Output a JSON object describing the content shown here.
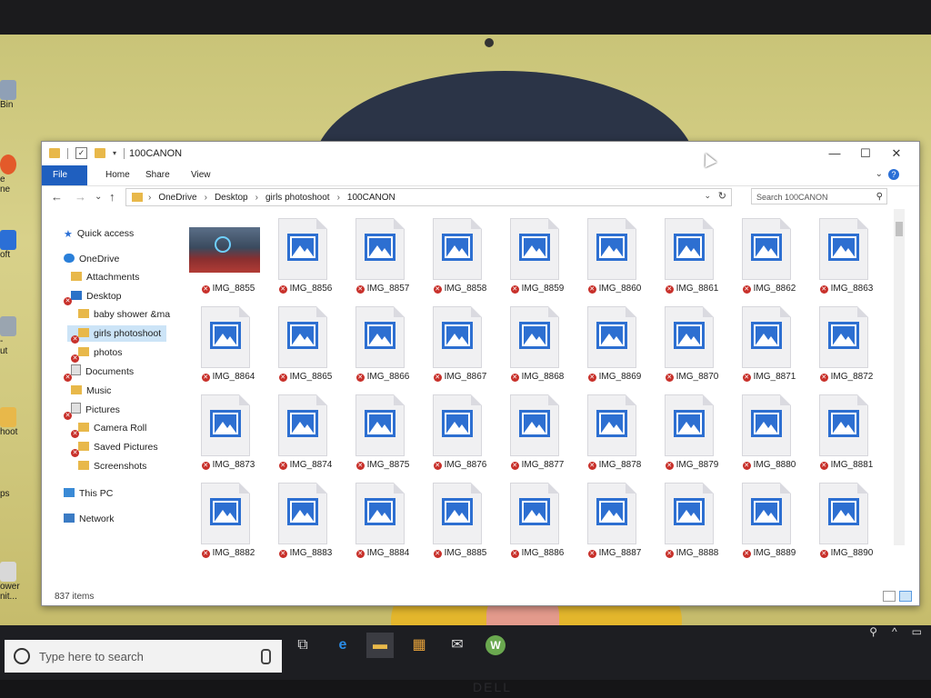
{
  "desktop": {
    "icons": [
      {
        "label": "Bin",
        "y": 0
      },
      {
        "label": "e",
        "y": 1
      },
      {
        "label": "ne",
        "y": 2
      },
      {
        "label": "oft",
        "y": 3
      },
      {
        "label": "-",
        "y": 4
      },
      {
        "label": "ut",
        "y": 5
      },
      {
        "label": "hoot",
        "y": 6
      },
      {
        "label": "ps",
        "y": 7
      },
      {
        "label": "ower",
        "y": 8
      },
      {
        "label": "nit...",
        "y": 9
      }
    ]
  },
  "window": {
    "title": "100CANON",
    "controls": {
      "minimize": "—",
      "maximize": "☐",
      "close": "✕"
    },
    "ribbon": {
      "file": "File",
      "home": "Home",
      "share": "Share",
      "view": "View",
      "help": "?",
      "expand": "⌄"
    },
    "nav": {
      "back": "←",
      "forward": "→",
      "recent": "⌄",
      "up": "↑"
    },
    "breadcrumb": [
      "OneDrive",
      "Desktop",
      "girls photoshoot",
      "100CANON"
    ],
    "search_placeholder": "Search 100CANON",
    "navpane": [
      {
        "label": "Quick access",
        "icon": "star-icon"
      },
      {
        "label": "OneDrive",
        "icon": "cloud-icon"
      },
      {
        "label": "Attachments",
        "icon": "folder-icon"
      },
      {
        "label": "Desktop",
        "icon": "desktop-icon"
      },
      {
        "label": "baby shower &ma",
        "icon": "folder-icon"
      },
      {
        "label": "girls photoshoot",
        "icon": "folder-icon"
      },
      {
        "label": "photos",
        "icon": "folder-icon"
      },
      {
        "label": "Documents",
        "icon": "documents-icon"
      },
      {
        "label": "Music",
        "icon": "folder-icon"
      },
      {
        "label": "Pictures",
        "icon": "pictures-icon"
      },
      {
        "label": "Camera Roll",
        "icon": "folder-icon"
      },
      {
        "label": "Saved Pictures",
        "icon": "folder-icon"
      },
      {
        "label": "Screenshots",
        "icon": "folder-icon"
      },
      {
        "label": "This PC",
        "icon": "pc-icon"
      },
      {
        "label": "Network",
        "icon": "network-icon"
      }
    ],
    "files": [
      "IMG_8855",
      "IMG_8856",
      "IMG_8857",
      "IMG_8858",
      "IMG_8859",
      "IMG_8860",
      "IMG_8861",
      "IMG_8862",
      "IMG_8863",
      "IMG_8864",
      "IMG_8865",
      "IMG_8866",
      "IMG_8867",
      "IMG_8868",
      "IMG_8869",
      "IMG_8870",
      "IMG_8871",
      "IMG_8872",
      "IMG_8873",
      "IMG_8874",
      "IMG_8875",
      "IMG_8876",
      "IMG_8877",
      "IMG_8878",
      "IMG_8879",
      "IMG_8880",
      "IMG_8881",
      "IMG_8882",
      "IMG_8883",
      "IMG_8884",
      "IMG_8885",
      "IMG_8886",
      "IMG_8887",
      "IMG_8888",
      "IMG_8889",
      "IMG_8890"
    ],
    "status": "837 items"
  },
  "taskbar": {
    "search_placeholder": "Type here to search",
    "apps": [
      "task-view",
      "edge",
      "file-explorer",
      "store",
      "mail",
      "word"
    ],
    "tray": [
      "⚲",
      "^",
      "▭"
    ]
  },
  "colors": {
    "accent": "#1f5fbf",
    "error_badge": "#c8302a",
    "image_blue": "#2d6fd1"
  }
}
